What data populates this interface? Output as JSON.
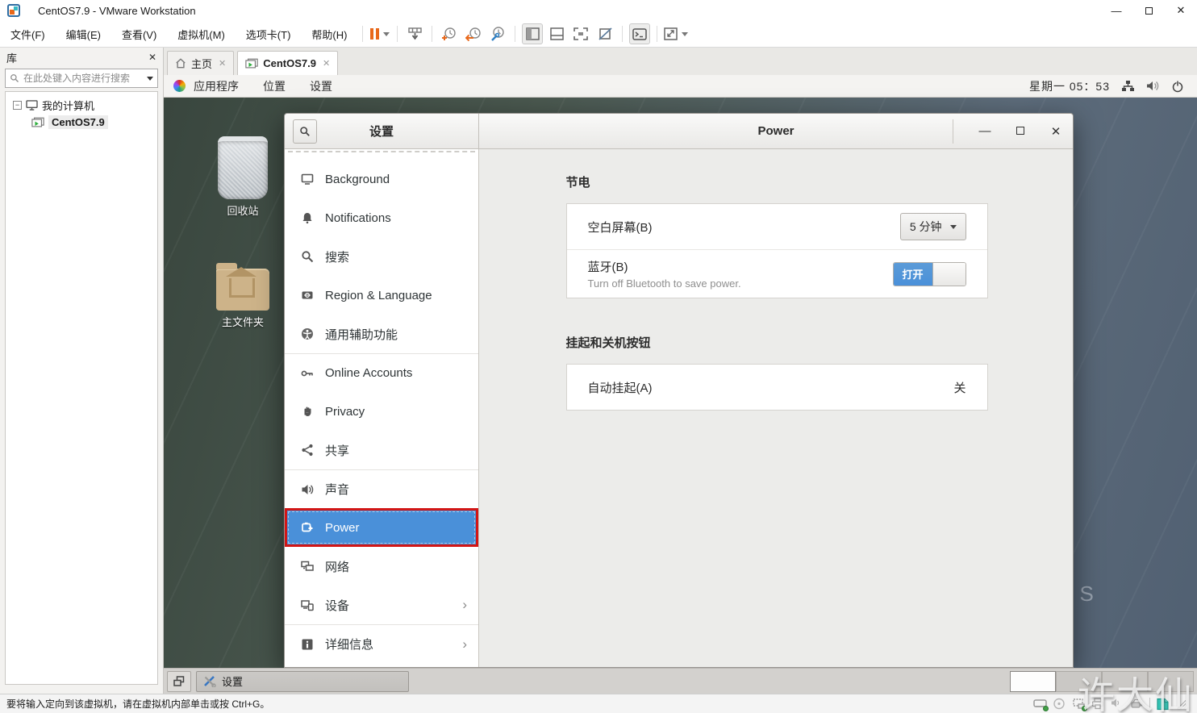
{
  "titlebar": {
    "title": "CentOS7.9  - VMware Workstation"
  },
  "menubar": [
    "文件(F)",
    "编辑(E)",
    "查看(V)",
    "虚拟机(M)",
    "选项卡(T)",
    "帮助(H)"
  ],
  "library": {
    "title": "库",
    "search_placeholder": "在此处键入内容进行搜索",
    "computer": "我的计算机",
    "vm_name": "CentOS7.9"
  },
  "tabbar": {
    "home": "主页",
    "vm": "CentOS7.9"
  },
  "guest": {
    "topbar": {
      "applications": "应用程序",
      "places": "位置",
      "settings": "设置",
      "clock": "星期一 05：53"
    },
    "desktop": {
      "trash_label": "回收站",
      "home_label": "主文件夹",
      "wallpaper_text": "O S"
    },
    "settings_window": {
      "left_header": "设置",
      "right_header": "Power",
      "sidebar": [
        {
          "label": "Background"
        },
        {
          "label": "Notifications"
        },
        {
          "label": "搜索"
        },
        {
          "label": "Region & Language"
        },
        {
          "label": "通用辅助功能"
        },
        {
          "label": "Online Accounts"
        },
        {
          "label": "Privacy"
        },
        {
          "label": "共享"
        },
        {
          "label": "声音"
        },
        {
          "label": "Power"
        },
        {
          "label": "网络"
        },
        {
          "label": "设备"
        },
        {
          "label": "详细信息"
        }
      ],
      "power_panel": {
        "saving_title": "节电",
        "blank_screen_label": "空白屏幕(B)",
        "blank_screen_value": "5 分钟",
        "bluetooth_label": "蓝牙(B)",
        "bluetooth_sub": "Turn off Bluetooth to save power.",
        "bluetooth_toggle": "打开",
        "suspend_title": "挂起和关机按钮",
        "auto_suspend_label": "自动挂起(A)",
        "auto_suspend_value": "关"
      }
    },
    "taskbar": {
      "task_settings": "设置"
    }
  },
  "statusbar": {
    "message": "要将输入定向到该虚拟机，请在虚拟机内部单击或按 Ctrl+G。"
  },
  "watermark": {
    "text": "许大仙"
  },
  "colors": {
    "accent": "#4a90d9",
    "highlight_red": "#d11616",
    "device_green": "#43a047",
    "pause_orange": "#e8681a"
  }
}
